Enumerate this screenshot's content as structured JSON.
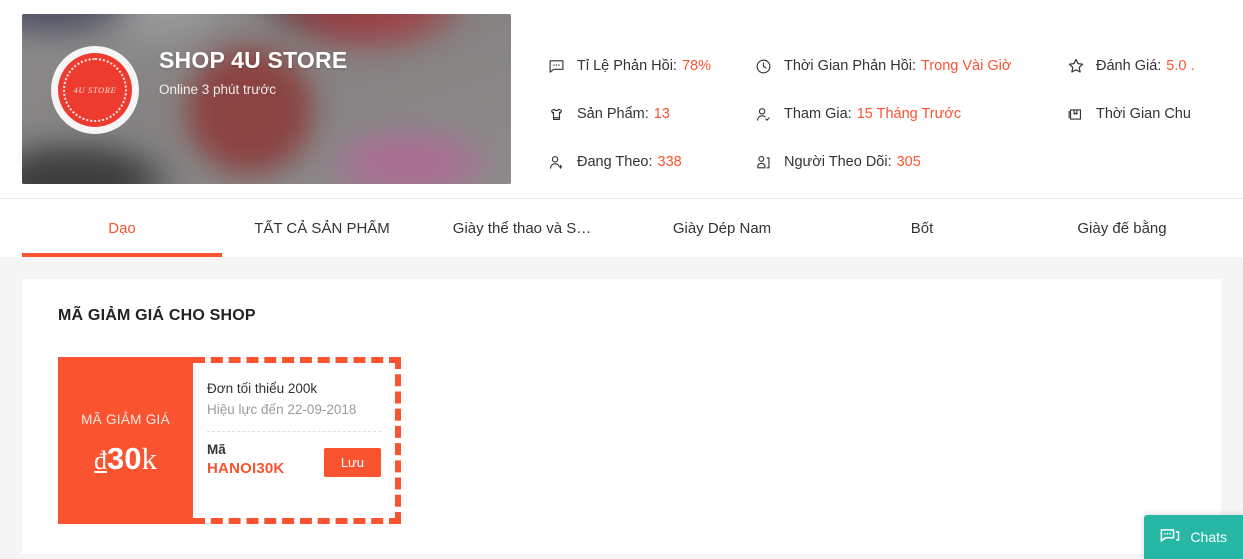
{
  "shop": {
    "name": "SHOP 4U STORE",
    "online_status": "Online 3 phút trước",
    "avatar_text": "4U STORE"
  },
  "stats": [
    {
      "icon": "chat-bubble-icon",
      "label": "Tỉ Lệ Phản Hồi:",
      "value": "78%"
    },
    {
      "icon": "clock-icon",
      "label": "Thời Gian Phản Hồi:",
      "value": "Trong Vài Giờ"
    },
    {
      "icon": "star-icon",
      "label": "Đánh Giá:",
      "value": "5.0 ."
    },
    {
      "icon": "tshirt-icon",
      "label": "Sản Phẩm:",
      "value": "13"
    },
    {
      "icon": "user-check-icon",
      "label": "Tham Gia:",
      "value": "15 Tháng Trước"
    },
    {
      "icon": "package-icon",
      "label": "Thời Gian Chu",
      "value": ""
    },
    {
      "icon": "user-plus-icon",
      "label": "Đang Theo:",
      "value": "338"
    },
    {
      "icon": "followers-icon",
      "label": "Người Theo Dõi:",
      "value": "305"
    }
  ],
  "nav": {
    "items": [
      {
        "label": "Dạo",
        "active": true
      },
      {
        "label": "TẤT CẢ SẢN PHẨM",
        "active": false
      },
      {
        "label": "Giày thể thao và S…",
        "active": false
      },
      {
        "label": "Giày Dép Nam",
        "active": false
      },
      {
        "label": "Bốt",
        "active": false
      },
      {
        "label": "Giày đế bằng",
        "active": false
      }
    ]
  },
  "panel": {
    "title": "MÃ GIẢM GIÁ CHO SHOP"
  },
  "voucher": {
    "left_label": "MÃ GIẢM GIÁ",
    "currency": "đ",
    "amount": "30",
    "unit": "k",
    "min_order": "Đơn tối thiểu 200k",
    "expiry": "Hiệu lực đến 22-09-2018",
    "code_label": "Mã",
    "code_value": "HANOI30K",
    "save_label": "Lưu"
  },
  "chat_widget": {
    "label": "Chats"
  },
  "colors": {
    "accent": "#f9532f",
    "chat_teal": "#26b8a5",
    "page_bg": "#f5f5f5",
    "text": "#333333",
    "muted": "#9b9b9b"
  }
}
